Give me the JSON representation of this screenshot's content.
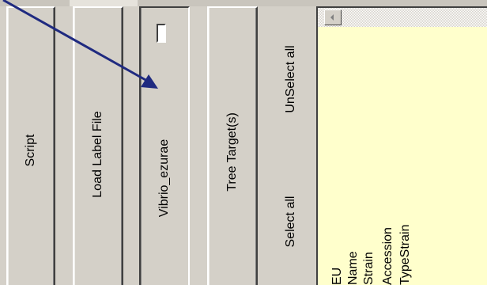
{
  "buttons": {
    "script": "Script",
    "load_label_file": "Load Label File",
    "organism": "Vibrio_ezurae",
    "tree_targets": "Tree Target(s)",
    "select_all": "Select all",
    "unselect_all": "UnSelect all"
  },
  "label_fields": [
    "EU",
    "Name",
    "Strain",
    "Accession",
    "TypeStrain"
  ],
  "colors": {
    "panel": "#d4d0c8",
    "list_background": "#ffffcc",
    "annotation_arrow": "#1f2a80"
  },
  "icons": {
    "scroll_left": "left-triangle-arrow",
    "annotation": "arrow-pointer"
  }
}
